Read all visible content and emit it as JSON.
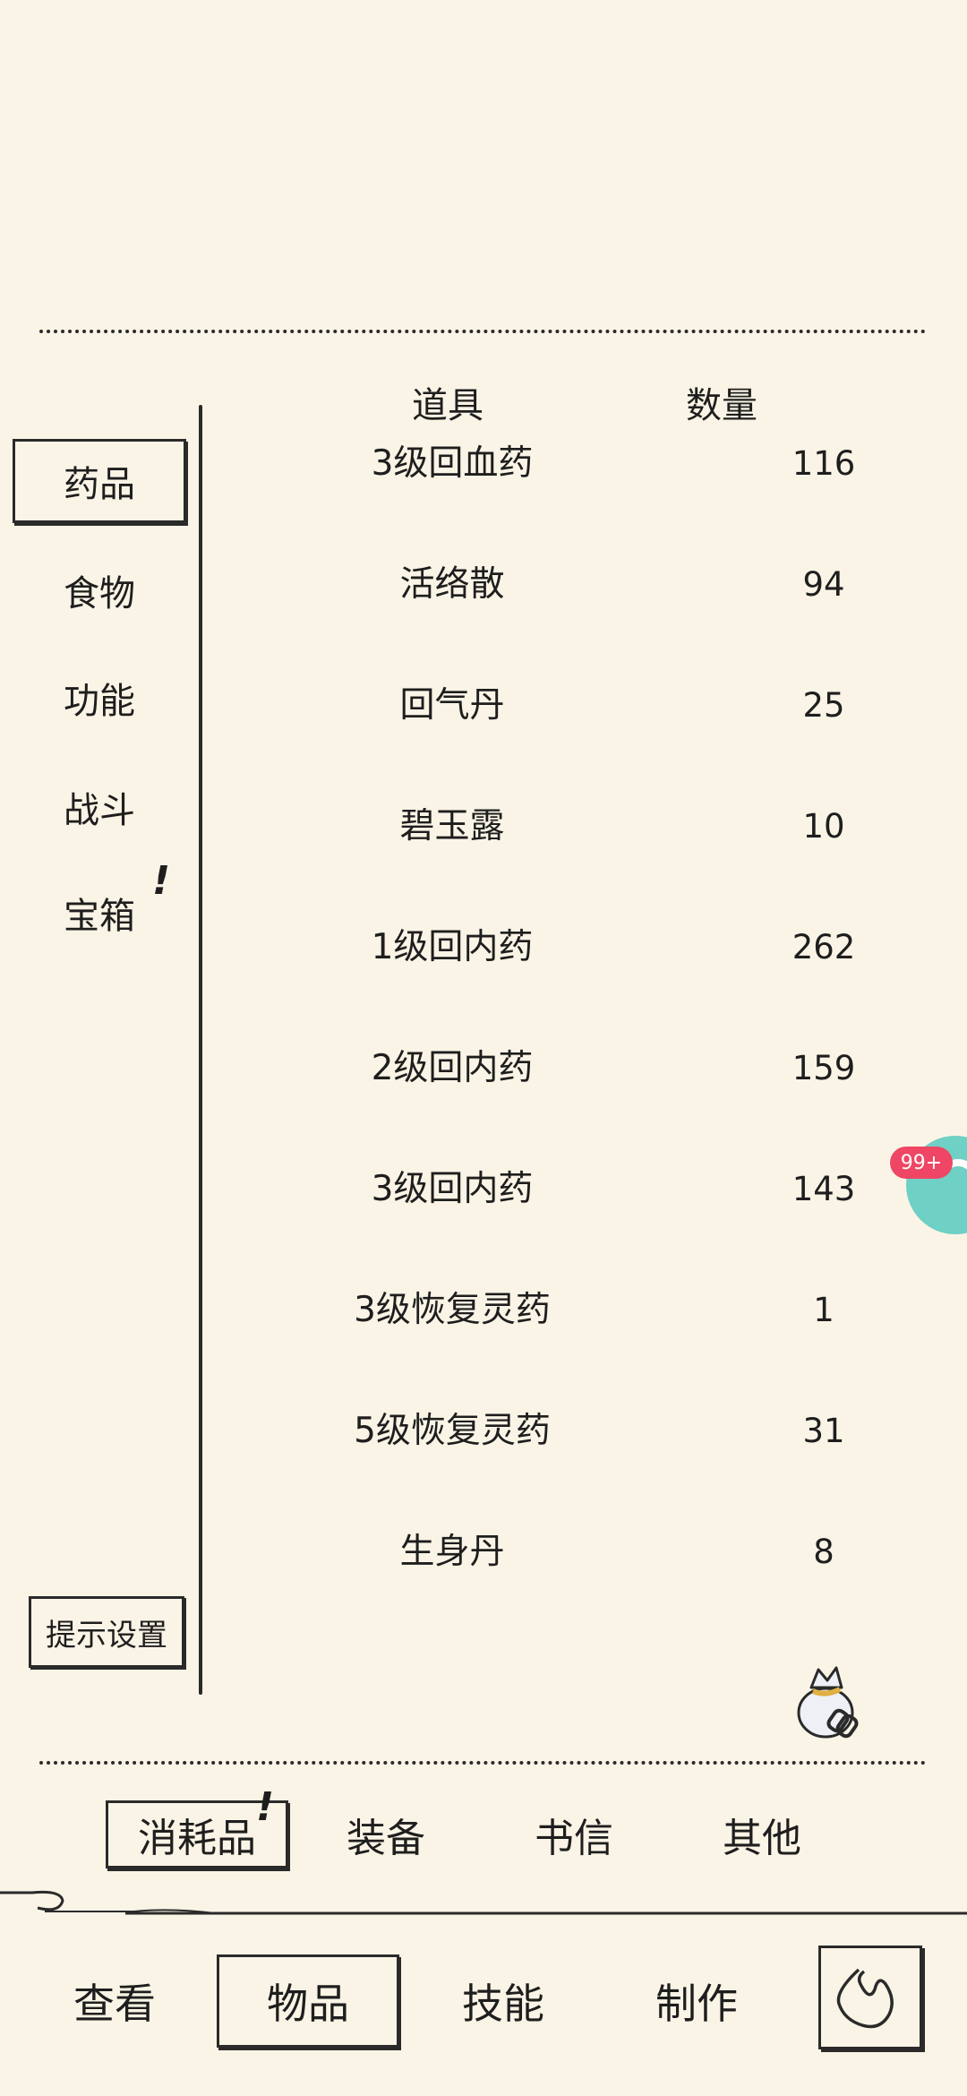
{
  "header": {
    "item_col": "道具",
    "qty_col": "数量"
  },
  "sidebar": {
    "items": [
      {
        "label": "药品",
        "active": true
      },
      {
        "label": "食物"
      },
      {
        "label": "功能"
      },
      {
        "label": "战斗"
      },
      {
        "label": "宝箱",
        "alert": "!"
      }
    ],
    "settings_label": "提示设置"
  },
  "items": [
    {
      "name": "3级回血药",
      "qty": "116"
    },
    {
      "name": "活络散",
      "qty": "94"
    },
    {
      "name": "回气丹",
      "qty": "25"
    },
    {
      "name": "碧玉露",
      "qty": "10"
    },
    {
      "name": "1级回内药",
      "qty": "262"
    },
    {
      "name": "2级回内药",
      "qty": "159"
    },
    {
      "name": "3级回内药",
      "qty": "143"
    },
    {
      "name": "3级恢复灵药",
      "qty": "1"
    },
    {
      "name": "5级恢复灵药",
      "qty": "31"
    },
    {
      "name": "生身丹",
      "qty": "8"
    }
  ],
  "floating_widget": {
    "badge": "99+",
    "color": "#6fd0c5",
    "badge_color": "#ee4664"
  },
  "category_tabs": [
    {
      "label": "消耗品",
      "active": true,
      "alert": "!"
    },
    {
      "label": "装备"
    },
    {
      "label": "书信"
    },
    {
      "label": "其他"
    }
  ],
  "bottom_nav": [
    {
      "label": "查看"
    },
    {
      "label": "物品",
      "active": true
    },
    {
      "label": "技能"
    },
    {
      "label": "制作"
    }
  ],
  "icons": {
    "bag": "loot-bag-icon",
    "back": "back-arrow-icon"
  }
}
